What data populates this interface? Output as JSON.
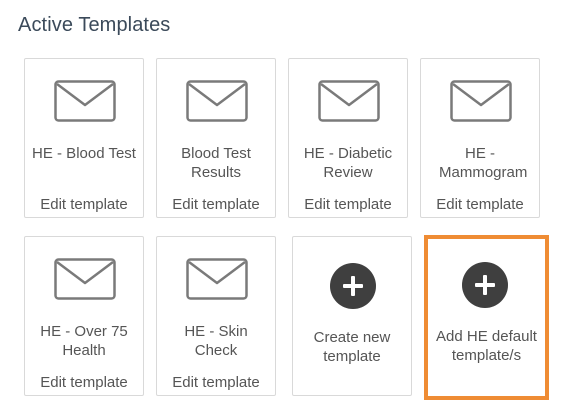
{
  "page": {
    "title": "Active Templates"
  },
  "templates": [
    {
      "name": "HE - Blood Test",
      "edit_label": "Edit template",
      "icon": "envelope-icon"
    },
    {
      "name": "Blood Test Results",
      "edit_label": "Edit template",
      "icon": "envelope-icon"
    },
    {
      "name": "HE - Diabetic Review",
      "edit_label": "Edit template",
      "icon": "envelope-icon"
    },
    {
      "name": "HE - Mammogram",
      "edit_label": "Edit template",
      "icon": "envelope-icon"
    },
    {
      "name": "HE - Over 75 Health",
      "edit_label": "Edit template",
      "icon": "envelope-icon"
    },
    {
      "name": "HE - Skin Check",
      "edit_label": "Edit template",
      "icon": "envelope-icon"
    }
  ],
  "actions": {
    "create": {
      "label": "Create new template",
      "icon": "plus-circle-icon"
    },
    "add_default": {
      "label": "Add HE default template/s",
      "icon": "plus-circle-icon"
    }
  },
  "colors": {
    "title": "#3b4a5a",
    "card_border": "#d9d9d9",
    "plus_circle": "#3f3f3f",
    "highlight": "#ef8c34"
  }
}
